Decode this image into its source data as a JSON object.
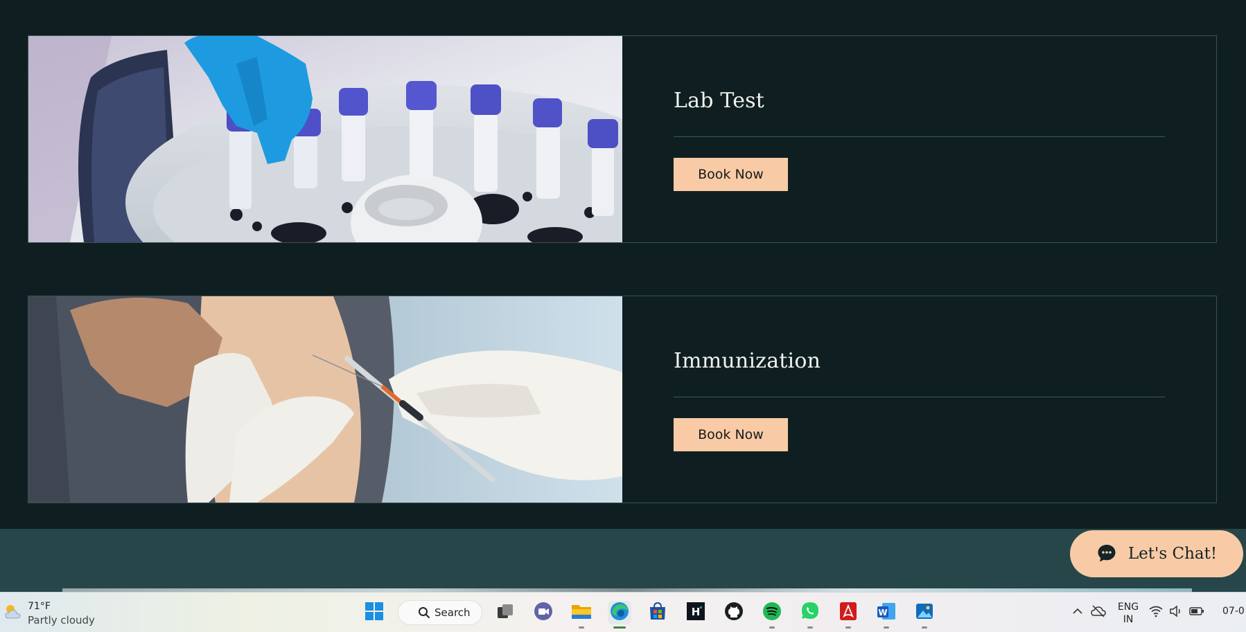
{
  "services": [
    {
      "title": "Lab Test",
      "button_label": "Book Now",
      "image": "lab-test-sample-tubes-photo"
    },
    {
      "title": "Immunization",
      "button_label": "Book Now",
      "image": "vaccination-injection-photo"
    }
  ],
  "chat": {
    "label": "Let's Chat!",
    "icon": "chat-bubble-icon"
  },
  "taskbar": {
    "weather": {
      "temperature": "71°F",
      "condition": "Partly cloudy"
    },
    "search_label": "Search",
    "apps": [
      "start",
      "search",
      "task-view",
      "teams",
      "file-explorer",
      "edge",
      "store",
      "hackerrank",
      "github",
      "spotify",
      "whatsapp",
      "acrobat",
      "word",
      "photos"
    ],
    "active_app": "edge",
    "language": {
      "line1": "ENG",
      "line2": "IN"
    },
    "clock": "07-0"
  },
  "colors": {
    "page_bg": "#0f1f21",
    "accent": "#f8cba6",
    "footer_band": "#26464a"
  }
}
